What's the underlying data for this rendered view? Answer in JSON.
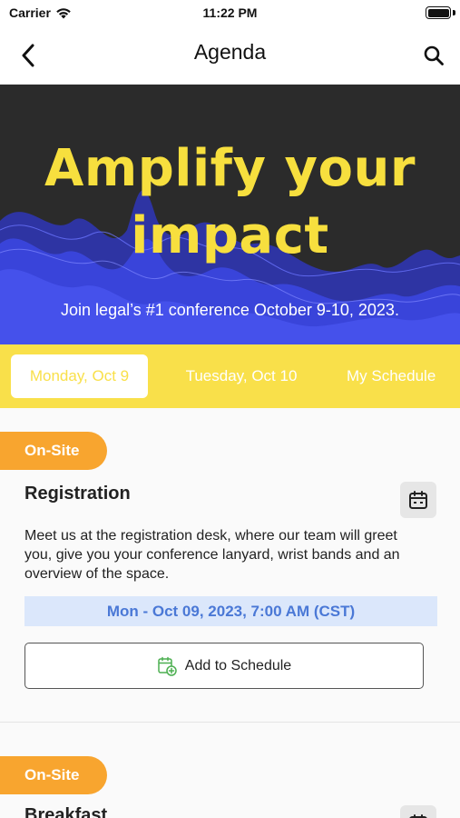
{
  "status_bar": {
    "carrier": "Carrier",
    "time": "11:22 PM",
    "wifi_icon": "wifi-icon",
    "battery_icon": "battery-icon"
  },
  "nav": {
    "title": "Agenda",
    "back_icon": "chevron-left-icon",
    "search_icon": "search-icon"
  },
  "banner": {
    "headline_line1": "Amplify your",
    "headline_line2": "impact",
    "tagline": "Join legal’s #1 conference October 9-10, 2023.",
    "headline_color": "#f7df3e",
    "background_color": "#2b2b2b",
    "wave_color": "#3b46e0"
  },
  "tabs": [
    {
      "label": "Monday, Oct 9",
      "active": true
    },
    {
      "label": "Tuesday, Oct 10",
      "active": false
    },
    {
      "label": "My Schedule",
      "active": false
    }
  ],
  "tabs_bar_color": "#f9e04a",
  "sessions": [
    {
      "badge": "On-Site",
      "title": "Registration",
      "description": "Meet us at the registration desk, where our team will greet you, give you your conference lanyard, wrist bands and an overview of the space.",
      "time": "Mon - Oct 09, 2023, 7:00 AM (CST)",
      "add_label": "Add to Schedule",
      "calendar_icon": "calendar-icon",
      "add_icon": "calendar-add-icon"
    },
    {
      "badge": "On-Site",
      "title": "Breakfast",
      "calendar_icon": "calendar-icon"
    }
  ],
  "colors": {
    "badge": "#f8a52f",
    "time_bg": "#dbe7fb",
    "time_text": "#4a78d6",
    "add_icon": "#4caf50"
  }
}
